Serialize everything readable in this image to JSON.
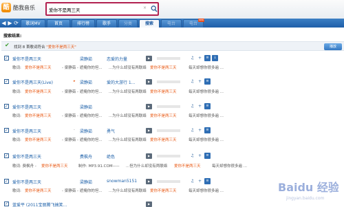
{
  "app": {
    "logo_char": "酷",
    "title": "酷我音乐"
  },
  "search": {
    "value": "爱你不是两三天",
    "clear": "×"
  },
  "nav": {
    "back": "◀",
    "forward": "▶",
    "refresh": "⟳",
    "tabs": [
      {
        "label": "歌词MV",
        "state": "normal"
      },
      {
        "label": "首页",
        "state": "normal"
      },
      {
        "label": "排行榜",
        "state": "normal"
      },
      {
        "label": "歌手",
        "state": "normal"
      },
      {
        "label": "分类",
        "state": "faded"
      },
      {
        "label": "搜索",
        "state": "active"
      },
      {
        "label": "电台",
        "state": "faded"
      },
      {
        "label": "电台",
        "state": "faded",
        "badge": "new"
      }
    ]
  },
  "results": {
    "section_label": "搜索结果:",
    "summary_prefix": "找到 8 首歌词符合",
    "summary_keyword": "\"爱你不是两三天\"",
    "play_all": "播放"
  },
  "rows": [
    {
      "title": "爱你不是两三天",
      "singer": "梁静茹",
      "album": "恋爱的力量",
      "live": false
    },
    {
      "title": "爱你不是两三天(Live)",
      "singer": "梁静茹",
      "album": "爱的大游行 1...",
      "live": true
    },
    {
      "title": "爱你不是两三天",
      "singer": "梁静茹",
      "album": "",
      "live": false
    },
    {
      "title": "爱你不是两三天",
      "singer": "梁静茹",
      "album": "勇气",
      "live": false
    },
    {
      "title": "爱你不是两三天",
      "singer": "费枫舟",
      "album": "绝色",
      "live": false
    },
    {
      "title": "爱你不是两三天",
      "singer": "梁静茹",
      "album": "snowman5151",
      "live": false
    },
    {
      "title": "蓝爱平 (2011宝丽腾飞搞笑...",
      "singer": "",
      "album": "",
      "live": false
    }
  ],
  "lyrics": [
    {
      "label": "歌词:",
      "a": "爱你不是两三天",
      "b": "- 梁静茹 - 遮掩你的坦...",
      "c": "...为什么却没有两联络",
      "d": "爱你不是两三天",
      "e": "每天却想你很多遍 ..."
    },
    {
      "label": "歌词:",
      "a": "爱你不是两三天",
      "b": "- 梁静茹 - 遮掩你的坦...",
      "c": "...为什么却没有两联络",
      "d": "爱你不是两三天",
      "e": "每天却想你很多遍 ..."
    },
    {
      "label": "歌词:",
      "a": "爱你不是两三天",
      "b": "- 梁静茹 - 遮掩你的坦...",
      "c": "...为什么却没有两联络",
      "d": "爱你不是两三天",
      "e": "每天却想你很多遍 ..."
    },
    {
      "label": "歌词:",
      "a": "爱你不是两三天",
      "b": "- 梁静茹 - 遮掩你的坦...",
      "c": "...为什么却没有两联络",
      "d": "爱你不是两三天",
      "e": "每天却想你很多遍 ..."
    },
    {
      "label": "歌词: 费枫舟 -",
      "a": "爱你不是两三天",
      "b": "制作: MP3.91.COM-----",
      "c": "...但为什么却没有两联络",
      "d": "爱你不是两三天",
      "e": "每天却想你很多遍 ..."
    },
    {
      "label": "歌词:",
      "a": "爱你不是两三天",
      "b": "- 梁静茹 - 遮掩你的坦...",
      "c": "...为什么却没有两联络",
      "d": "爱你不是两三天",
      "e": "每天却想你很多遍 ..."
    }
  ],
  "watermark": {
    "text": "Baidu 经验",
    "sub": "jingyan.baidu.com"
  },
  "colors": {
    "accent": "#1e5ea8",
    "search_border": "#b1204f",
    "keyword": "#e8540c",
    "link": "#1b5fa8"
  }
}
